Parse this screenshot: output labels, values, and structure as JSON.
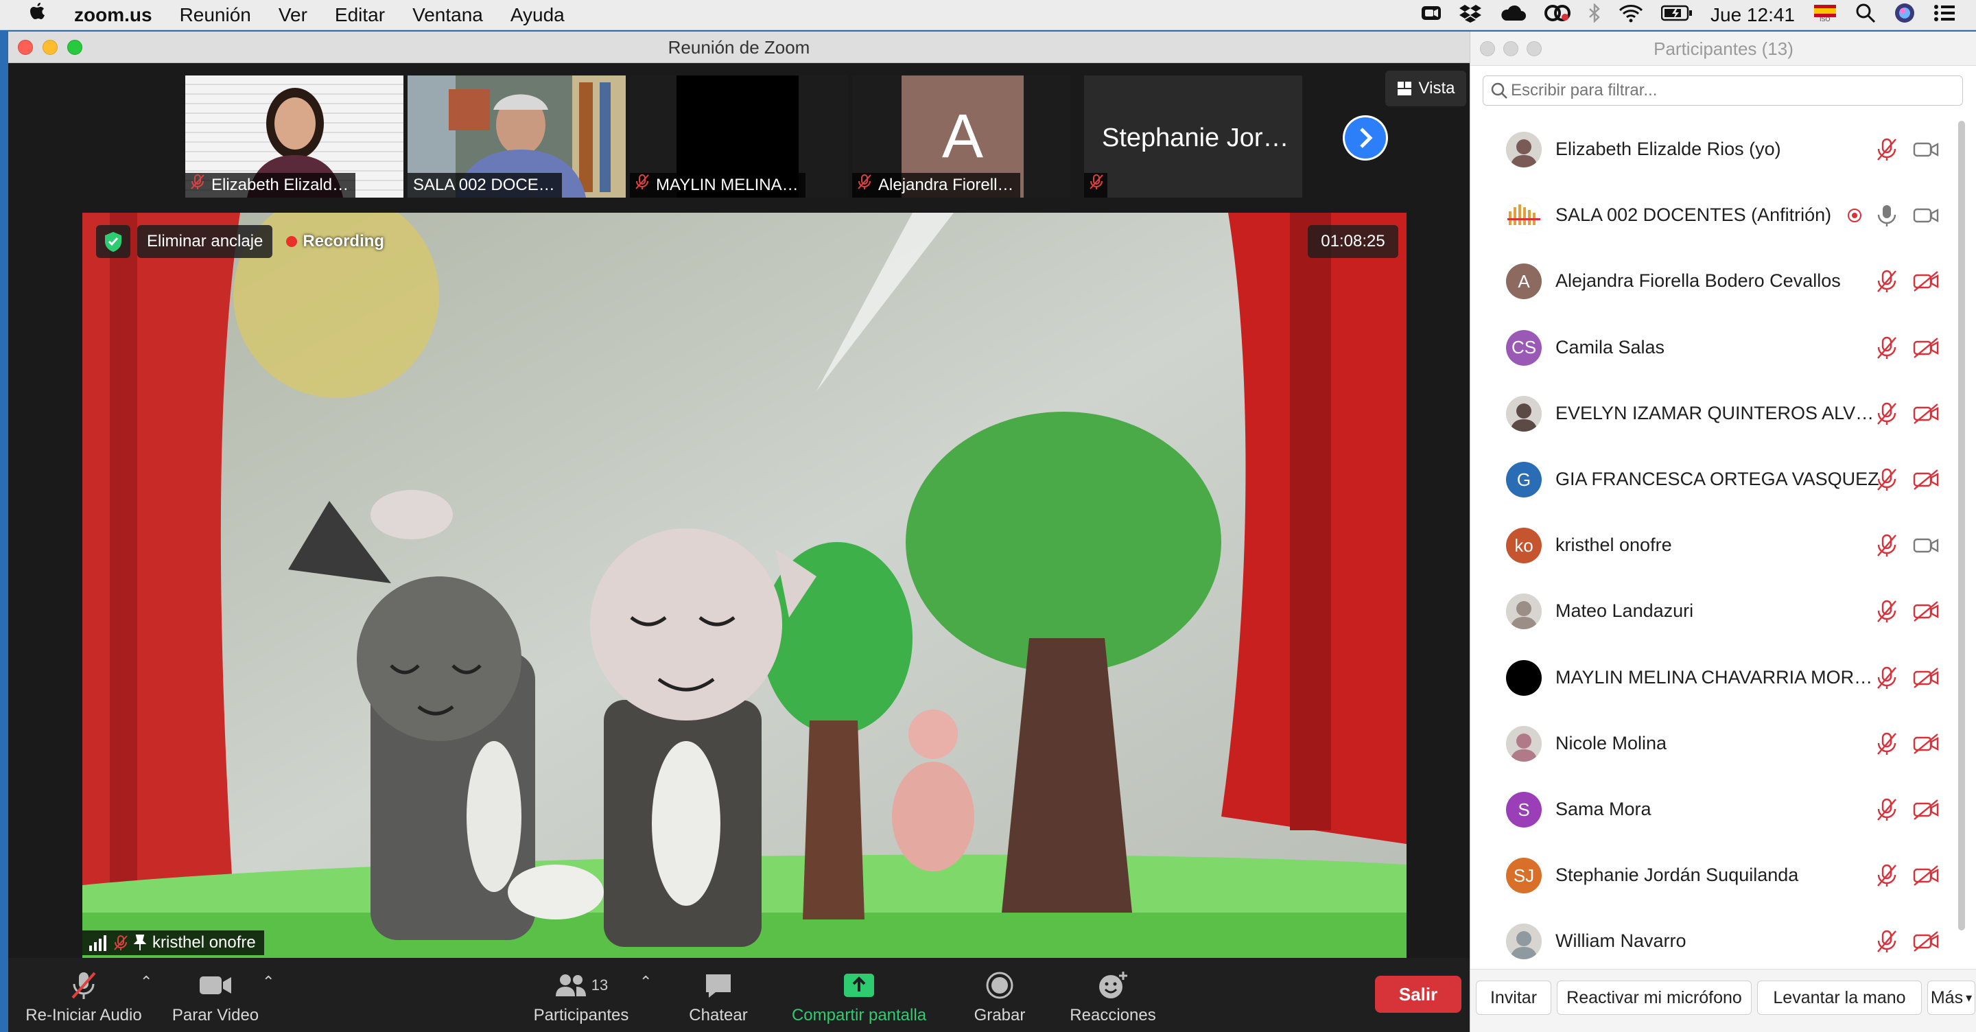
{
  "menubar": {
    "app": "zoom.us",
    "items": [
      "Reunión",
      "Ver",
      "Editar",
      "Ventana",
      "Ayuda"
    ],
    "clock": "Jue 12:41",
    "flag_label": "ISO"
  },
  "window": {
    "title": "Reunión de Zoom"
  },
  "thumbnails": [
    {
      "name": "Elizabeth Elizald…",
      "kind": "video",
      "muted": true
    },
    {
      "name": "SALA 002 DOCE…",
      "kind": "video",
      "muted": false
    },
    {
      "name": "MAYLIN MELINA…",
      "kind": "black",
      "muted": true
    },
    {
      "name": "Alejandra Fiorell…",
      "kind": "avatar",
      "initial": "A",
      "muted": true
    },
    {
      "name": "Stephanie Jor…",
      "kind": "nameonly",
      "muted": true
    }
  ],
  "view_button": "Vista",
  "recording": {
    "unpin_label": "Eliminar anclaje",
    "status": "Recording",
    "timer": "01:08:25"
  },
  "active_speaker": "kristhel onofre",
  "toolbar": {
    "audio": "Re-Iniciar Audio",
    "video": "Parar Video",
    "participants": "Participantes",
    "participants_count": "13",
    "chat": "Chatear",
    "share": "Compartir pantalla",
    "record": "Grabar",
    "reactions": "Reacciones",
    "leave": "Salir"
  },
  "panel": {
    "title": "Participantes (13)",
    "filter_placeholder": "Escribir para filtrar...",
    "participants": [
      {
        "name": "Elizabeth Elizalde Rios (yo)",
        "avatar": "photo",
        "color": "#7a5a55",
        "mic": "off",
        "cam": "on"
      },
      {
        "name": "SALA 002 DOCENTES (Anfitrión)",
        "avatar": "logo",
        "color": "#e0a040",
        "mic": "on",
        "cam": "on",
        "recording": true
      },
      {
        "name": "Alejandra Fiorella Bodero Cevallos",
        "avatar": "A",
        "color": "#8c6a60",
        "mic": "off",
        "cam": "off"
      },
      {
        "name": "Camila Salas",
        "avatar": "CS",
        "color": "#9b59b6",
        "mic": "off",
        "cam": "off"
      },
      {
        "name": "EVELYN IZAMAR QUINTEROS ALV…",
        "avatar": "photo",
        "color": "#5b4a45",
        "mic": "off",
        "cam": "off"
      },
      {
        "name": "GIA FRANCESCA ORTEGA VASQUEZ",
        "avatar": "G",
        "color": "#2a6db5",
        "mic": "off",
        "cam": "off"
      },
      {
        "name": "kristhel onofre",
        "avatar": "ko",
        "color": "#c4552f",
        "mic": "off",
        "cam": "on"
      },
      {
        "name": "Mateo Landazuri",
        "avatar": "photo",
        "color": "#9a8e86",
        "mic": "off",
        "cam": "off"
      },
      {
        "name": "MAYLIN MELINA CHAVARRIA MOR…",
        "avatar": "black",
        "color": "#000000",
        "mic": "off",
        "cam": "off"
      },
      {
        "name": "Nicole Molina",
        "avatar": "photo",
        "color": "#b07a88",
        "mic": "off",
        "cam": "off"
      },
      {
        "name": "Sama Mora",
        "avatar": "S",
        "color": "#9b3fb8",
        "mic": "off",
        "cam": "off"
      },
      {
        "name": "Stephanie Jordán Suquilanda",
        "avatar": "SJ",
        "color": "#d9702a",
        "mic": "off",
        "cam": "off"
      },
      {
        "name": "William Navarro",
        "avatar": "photo",
        "color": "#8e9aa0",
        "mic": "off",
        "cam": "off"
      }
    ],
    "buttons": {
      "invite": "Invitar",
      "unmute": "Reactivar mi micrófono",
      "raise_hand": "Levantar la mano",
      "more": "Más"
    }
  },
  "colors": {
    "accent_green": "#2ecc71",
    "leave_red": "#d7343a",
    "muted_red": "#d9303a",
    "link_blue": "#2d7ff9"
  }
}
